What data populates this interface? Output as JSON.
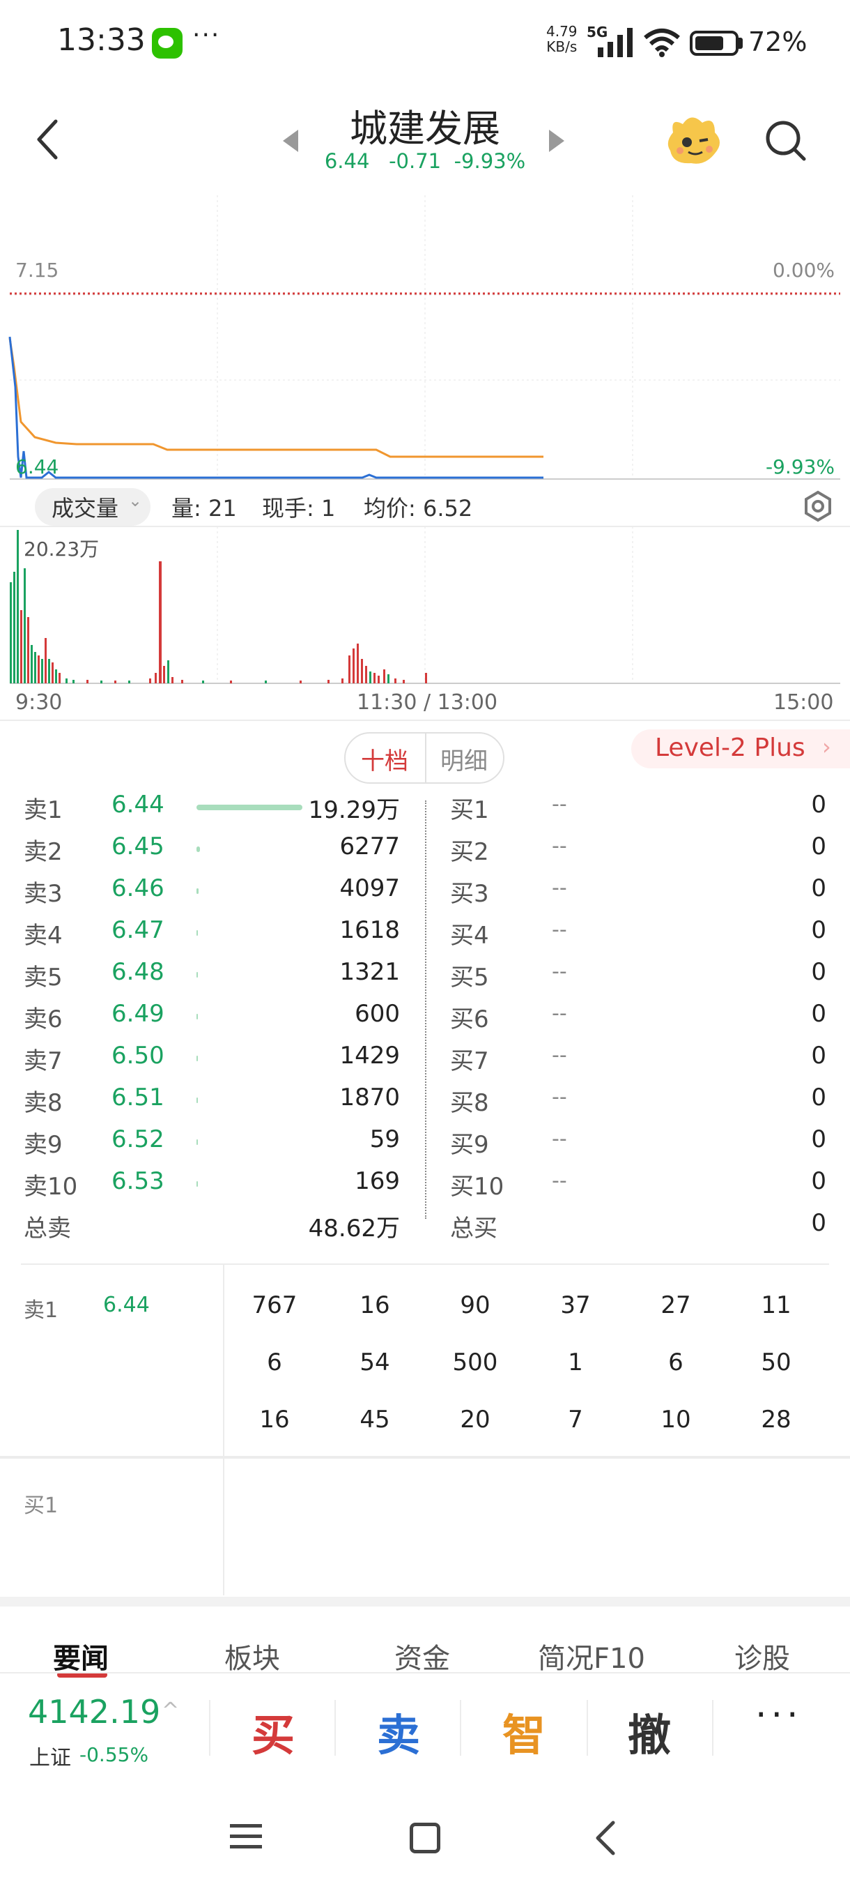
{
  "status": {
    "time": "13:33",
    "more_dots": "···",
    "net_speed_value": "4.79",
    "net_speed_unit": "KB/s",
    "network": "5G",
    "battery": "72%"
  },
  "header": {
    "title": "城建发展",
    "price": "6.44",
    "change": "-0.71",
    "pct": "-9.93%"
  },
  "chart": {
    "top_left": "7.15",
    "top_right": "0.00%",
    "bottom_left": "6.44",
    "bottom_right": "-9.93%",
    "vol_max": "20.23万",
    "time_start": "9:30",
    "time_mid": "11:30 / 13:00",
    "time_end": "15:00"
  },
  "volume_bar": {
    "selector": "成交量",
    "qty": "量: 21",
    "hand": "现手: 1",
    "avg": "均价: 6.52"
  },
  "colors": {
    "up": "#d43a3a",
    "down": "#1aa260",
    "avg_line": "#f0962e",
    "price_line": "#2b6fd4"
  },
  "tabs": {
    "ten_levels": "十档",
    "detail": "明细",
    "level2": "Level-2 Plus"
  },
  "asks": [
    {
      "label": "卖1",
      "price": "6.44",
      "vol": "19.29万",
      "bar": 1.0
    },
    {
      "label": "卖2",
      "price": "6.45",
      "vol": "6277",
      "bar": 0.033
    },
    {
      "label": "卖3",
      "price": "6.46",
      "vol": "4097",
      "bar": 0.021
    },
    {
      "label": "卖4",
      "price": "6.47",
      "vol": "1618",
      "bar": 0.008
    },
    {
      "label": "卖5",
      "price": "6.48",
      "vol": "1321",
      "bar": 0.007
    },
    {
      "label": "卖6",
      "price": "6.49",
      "vol": "600",
      "bar": 0.003
    },
    {
      "label": "卖7",
      "price": "6.50",
      "vol": "1429",
      "bar": 0.007
    },
    {
      "label": "卖8",
      "price": "6.51",
      "vol": "1870",
      "bar": 0.01
    },
    {
      "label": "卖9",
      "price": "6.52",
      "vol": "59",
      "bar": 0.0
    },
    {
      "label": "卖10",
      "price": "6.53",
      "vol": "169",
      "bar": 0.0
    }
  ],
  "bids": [
    {
      "label": "买1",
      "price": "--",
      "vol": "0"
    },
    {
      "label": "买2",
      "price": "--",
      "vol": "0"
    },
    {
      "label": "买3",
      "price": "--",
      "vol": "0"
    },
    {
      "label": "买4",
      "price": "--",
      "vol": "0"
    },
    {
      "label": "买5",
      "price": "--",
      "vol": "0"
    },
    {
      "label": "买6",
      "price": "--",
      "vol": "0"
    },
    {
      "label": "买7",
      "price": "--",
      "vol": "0"
    },
    {
      "label": "买8",
      "price": "--",
      "vol": "0"
    },
    {
      "label": "买9",
      "price": "--",
      "vol": "0"
    },
    {
      "label": "买10",
      "price": "--",
      "vol": "0"
    }
  ],
  "totals": {
    "sell_label": "总卖",
    "sell_vol": "48.62万",
    "buy_label": "总买",
    "buy_vol": "0"
  },
  "queue": {
    "sell_label": "卖1",
    "sell_price": "6.44",
    "sell_orders": [
      [
        "767",
        "16",
        "90",
        "37",
        "27",
        "11"
      ],
      [
        "6",
        "54",
        "500",
        "1",
        "6",
        "50"
      ],
      [
        "16",
        "45",
        "20",
        "7",
        "10",
        "28"
      ]
    ],
    "buy_label": "买1"
  },
  "bottom_tabs": [
    "要闻",
    "板块",
    "资金",
    "简况F10",
    "诊股"
  ],
  "action_bar": {
    "index_value": "4142.19",
    "index_name": "上证",
    "index_change": "-0.55%",
    "buy": "买",
    "sell": "卖",
    "smart": "智",
    "cancel": "撤",
    "more": "···"
  }
}
